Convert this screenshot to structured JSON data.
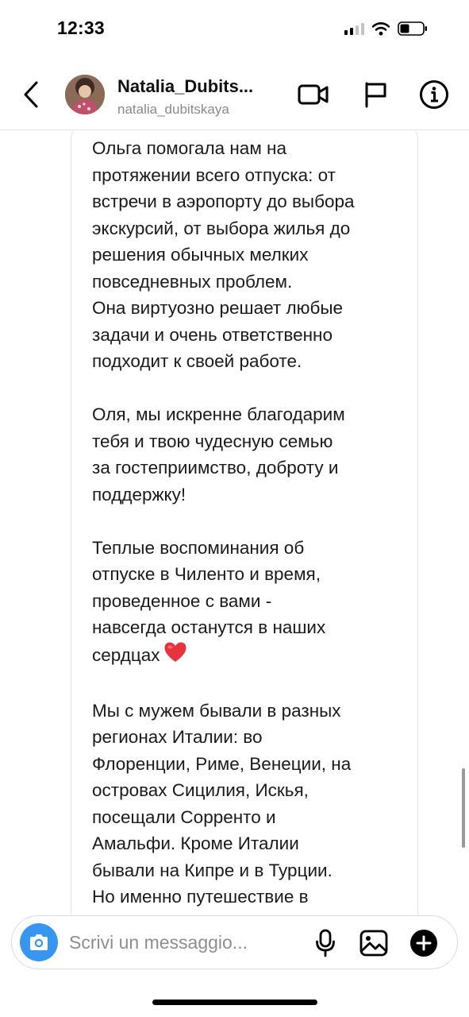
{
  "status_bar": {
    "time": "12:33",
    "icons": [
      "cellular-signal-icon",
      "wifi-icon",
      "battery-icon"
    ]
  },
  "header": {
    "display_name": "Natalia_Dubits...",
    "username": "natalia_dubitskaya",
    "icons": [
      "chevron-left-icon",
      "video-camera-icon",
      "flag-icon",
      "info-icon"
    ]
  },
  "message": {
    "lines": [
      "Ольга помогала нам на",
      "протяжении всего отпуска: от",
      "встречи в аэропорту до выбора",
      "экскурсий, от выбора жилья до",
      "решения обычных мелких",
      "повседневных проблем.",
      "Она виртуозно решает любые",
      "задачи и очень ответственно",
      "подходит к своей работе.",
      "",
      "Оля, мы искренне благодарим",
      "тебя и твою чудесную семью",
      "за гостеприимство, доброту и",
      "поддержку!",
      "",
      "Теплые воспоминания об",
      "отпуске в Чиленто и время,",
      "проведенное с вами -",
      "навсегда останутся в наших",
      "сердцах",
      "",
      "Мы с мужем бывали в разных",
      "регионах Италии: во",
      "Флоренции, Риме, Венеции, на",
      "островах Сицилия, Искья,",
      "посещали Сорренто и",
      "Амальфи. Кроме Италии",
      "бывали на Кипре и в Турции.",
      "Но именно путешествие в"
    ],
    "emoji": "heart-emoji"
  },
  "composer": {
    "placeholder": "Scrivi un messaggio...",
    "icons": [
      "camera-icon",
      "microphone-icon",
      "gallery-icon",
      "add-icon"
    ]
  },
  "colors": {
    "accent": "#3797f0",
    "heart": "#e8323c",
    "secondary_text": "#8e8e8e",
    "border": "#e3e3e3"
  }
}
